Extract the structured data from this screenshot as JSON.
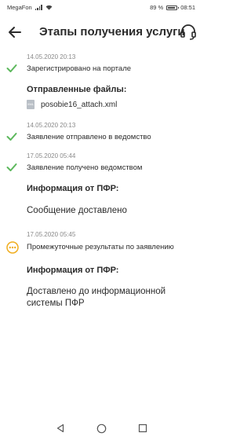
{
  "status": {
    "carrier": "MegaFon",
    "battery_text": "89 %",
    "battery_level": 0.89,
    "time": "08:51"
  },
  "header": {
    "title": "Этапы получения услуги",
    "back_icon": "back-arrow-icon",
    "support_icon": "headset-icon"
  },
  "timeline": {
    "e1": {
      "date": "14.05.2020 20:13",
      "text": "Зарегистрировано на портале",
      "status": "done"
    },
    "files": {
      "heading": "Отправленные файлы:",
      "items": [
        {
          "name": "posobie16_attach.xml",
          "icon": "xml-file-icon"
        }
      ]
    },
    "e2": {
      "date": "14.05.2020 20:13",
      "text": "Заявление отправлено в ведомство",
      "status": "done"
    },
    "e3": {
      "date": "17.05.2020 05:44",
      "text": "Заявление получено ведомством",
      "status": "done"
    },
    "info1": {
      "heading": "Информация от ПФР:",
      "text": "Сообщение доставлено"
    },
    "e4": {
      "date": "17.05.2020 05:45",
      "text": "Промежуточные результаты по заявлению",
      "status": "in-progress"
    },
    "info2": {
      "heading": "Информация от ПФР:",
      "line1": "Доставлено до информационной",
      "line2": "системы ПФР"
    }
  },
  "colors": {
    "accent": "#5cb85c",
    "pending": "#f0ad1e",
    "muted": "#8a8a8a",
    "text": "#2b2b2b"
  }
}
